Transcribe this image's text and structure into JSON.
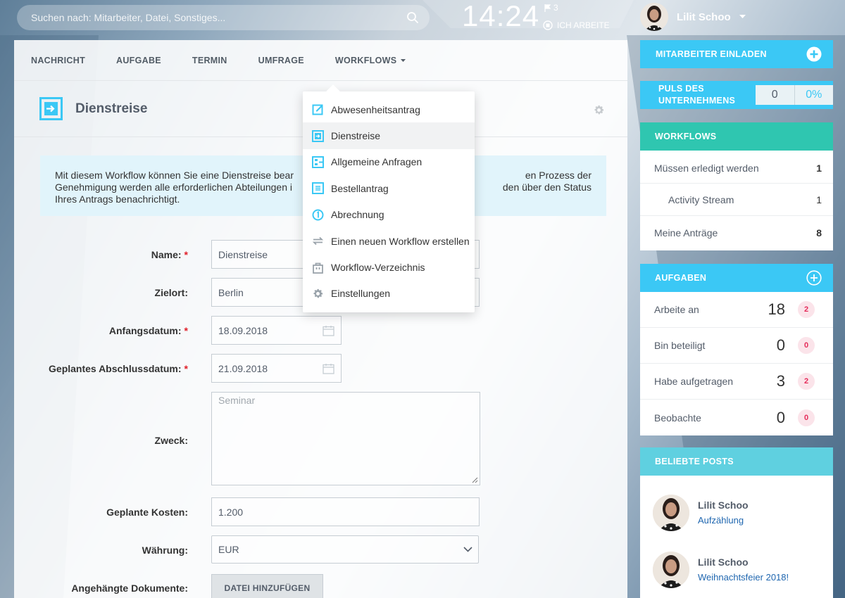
{
  "search": {
    "placeholder": "Suchen nach: Mitarbeiter, Datei, Sonstiges..."
  },
  "clock": "14:24",
  "flag_count": "3",
  "work_status": "ICH ARBEITE",
  "user": {
    "name": "Lilit Schoo"
  },
  "tabs": [
    "NACHRICHT",
    "AUFGABE",
    "TERMIN",
    "UMFRAGE",
    "WORKFLOWS"
  ],
  "page": {
    "title": "Dienstreise",
    "info_line1": "Mit diesem Workflow können Sie eine Dienstreise bear",
    "info_line1b": "en Prozess der",
    "info_line2": "Genehmigung werden alle erforderlichen Abteilungen i",
    "info_line2b": "den über den Status",
    "info_line3": "Ihres Antrags benachrichtigt."
  },
  "form": {
    "name_label": "Name:",
    "name_value": "Dienstreise",
    "ziel_label": "Zielort:",
    "ziel_value": "Berlin",
    "start_label": "Anfangsdatum:",
    "start_value": "18.09.2018",
    "end_label": "Geplantes Abschlussdatum:",
    "end_value": "21.09.2018",
    "zweck_label": "Zweck:",
    "zweck_value": "Seminar",
    "kosten_label": "Geplante Kosten:",
    "kosten_value": "1.200",
    "waehrung_label": "Währung:",
    "waehrung_value": "EUR",
    "docs_label": "Angehängte Dokumente:",
    "docs_button": "DATEI HINZUFÜGEN",
    "required_mark": "*"
  },
  "dropdown": {
    "items": [
      {
        "label": "Abwesenheitsantrag",
        "icon": "edit-icon"
      },
      {
        "label": "Dienstreise",
        "icon": "arrow-box-icon"
      },
      {
        "label": "Allgemeine Anfragen",
        "icon": "request-icon"
      },
      {
        "label": "Bestellantrag",
        "icon": "order-icon"
      },
      {
        "label": "Abrechnung",
        "icon": "coin-icon"
      },
      {
        "label": "Einen neuen Workflow erstellen",
        "icon": "refresh-icon"
      },
      {
        "label": "Workflow-Verzeichnis",
        "icon": "bag-icon"
      },
      {
        "label": "Einstellungen",
        "icon": "gear-icon"
      }
    ]
  },
  "sidebar": {
    "invite_label": "MITARBEITER EINLADEN",
    "pulse_label_1": "PULS DES",
    "pulse_label_2": "UNTERNEHMENS",
    "pulse_value": "0",
    "pulse_percent": "0%",
    "workflows": {
      "title": "WORKFLOWS",
      "rows": [
        {
          "label": "Müssen erledigt werden",
          "count": "1"
        },
        {
          "label": "Activity Stream",
          "count": "1"
        },
        {
          "label": "Meine Anträge",
          "count": "8"
        }
      ]
    },
    "tasks": {
      "title": "AUFGABEN",
      "rows": [
        {
          "label": "Arbeite an",
          "count": "18",
          "badge": "2"
        },
        {
          "label": "Bin beteiligt",
          "count": "0",
          "badge": "0"
        },
        {
          "label": "Habe aufgetragen",
          "count": "3",
          "badge": "2"
        },
        {
          "label": "Beobachte",
          "count": "0",
          "badge": "0"
        }
      ]
    },
    "posts": {
      "title": "BELIEBTE POSTS",
      "items": [
        {
          "author": "Lilit Schoo",
          "title": "Aufzählung"
        },
        {
          "author": "Lilit Schoo",
          "title": "Weihnachtsfeier 2018!"
        }
      ]
    }
  },
  "colors": {
    "accent_blue": "#3bc8f5",
    "workflow_green": "#2fc6b0",
    "posts_teal": "#5fd0e0",
    "badge_red": "#e52c5a"
  }
}
